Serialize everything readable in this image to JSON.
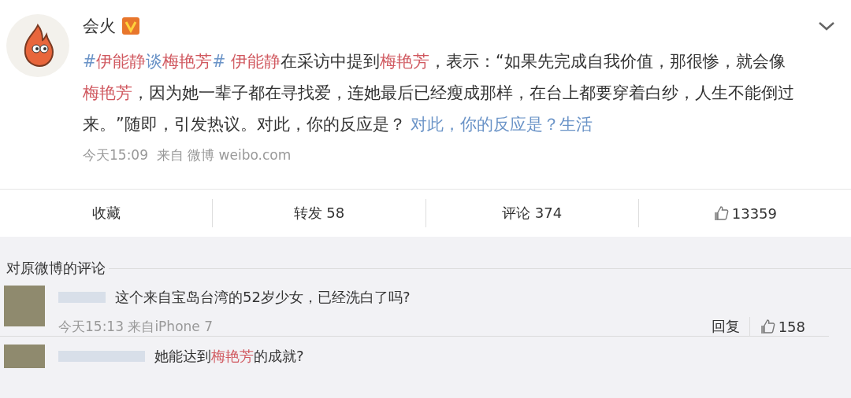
{
  "post": {
    "author": "会火",
    "verified": true,
    "body": [
      {
        "kind": "topic",
        "text": "#"
      },
      {
        "kind": "keyword",
        "text": "伊能静"
      },
      {
        "kind": "topic",
        "text": "谈"
      },
      {
        "kind": "keyword",
        "text": "梅艳芳"
      },
      {
        "kind": "topic",
        "text": "#"
      },
      {
        "kind": "keyword",
        "text": " 伊能静"
      },
      {
        "kind": "plain",
        "text": "在采访中提到"
      },
      {
        "kind": "keyword",
        "text": "梅艳芳"
      },
      {
        "kind": "plain",
        "text": "，表示：“如果先完成自我价值，那很惨，就会像"
      },
      {
        "kind": "keyword",
        "text": "梅艳芳"
      },
      {
        "kind": "plain",
        "text": "，因为她一辈子都在寻找爱，连她最后已经瘦成那样，在台上都要穿着白纱，人生不能倒过来。”随即，引发热议。对此，你的反应是？ "
      },
      {
        "kind": "topic",
        "text": "对此，你的反应是？生活"
      }
    ],
    "time": "今天15:09",
    "source": "来自 微博 weibo.com"
  },
  "actions": [
    {
      "kind": "text",
      "label": "收藏"
    },
    {
      "kind": "text",
      "label": "转发 58"
    },
    {
      "kind": "text",
      "label": "评论 374"
    },
    {
      "kind": "like",
      "label": "13359"
    }
  ],
  "comments_header": "对原微博的评论",
  "comments": [
    {
      "body": [
        {
          "kind": "plain",
          "text": "这个来自宝岛台湾的52岁少女，已经洗白了吗?"
        }
      ],
      "time": "今天15:13 来自iPhone 7",
      "reply": "回复",
      "likes": "158"
    },
    {
      "body": [
        {
          "kind": "plain",
          "text": "她能达到"
        },
        {
          "kind": "keyword",
          "text": "梅艳芳"
        },
        {
          "kind": "plain",
          "text": "的成就?"
        }
      ]
    }
  ]
}
